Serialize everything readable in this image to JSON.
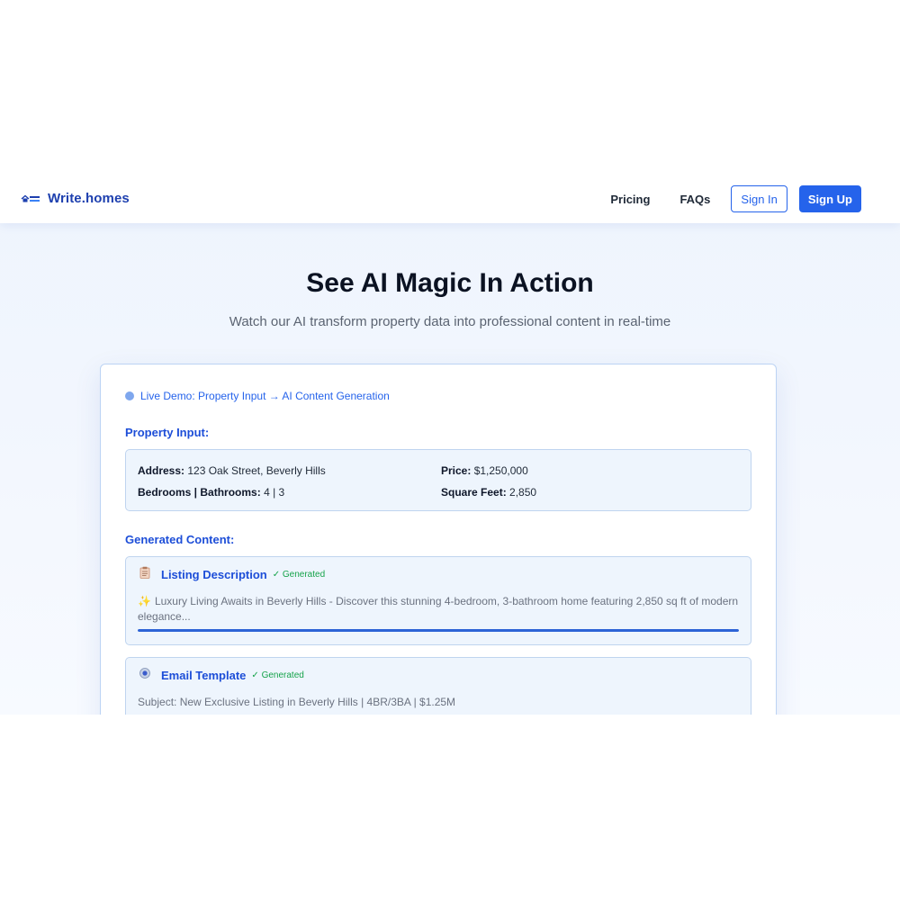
{
  "header": {
    "brand_name": "Write.homes",
    "nav": {
      "pricing": "Pricing",
      "faqs": "FAQs"
    },
    "sign_in": "Sign In",
    "sign_up": "Sign Up"
  },
  "hero": {
    "title": "See AI Magic In Action",
    "subtitle": "Watch our AI transform property data into professional content in real-time"
  },
  "demo": {
    "live_label": "Live Demo: Property Input → AI Content Generation",
    "property_input_label": "Property Input:",
    "property": {
      "address_label": "Address:",
      "address": "123 Oak Street, Beverly Hills",
      "bedbath_label": "Bedrooms | Bathrooms:",
      "bedbath": "4 | 3",
      "price_label": "Price:",
      "price": "$1,250,000",
      "sqft_label": "Square Feet:",
      "sqft": "2,850"
    },
    "generated_label": "Generated Content:",
    "items": [
      {
        "title": "Listing Description",
        "status": "✓ Generated",
        "icon": "clipboard-icon",
        "sparkle": "✨",
        "body": "Luxury Living Awaits in Beverly Hills - Discover this stunning 4-bedroom, 3-bathroom home featuring 2,850 sq ft of modern elegance...",
        "progress": 1.0
      },
      {
        "title": "Email Template",
        "status": "✓ Generated",
        "icon": "email-icon",
        "body": "Subject: New Exclusive Listing in Beverly Hills | 4BR/3BA | $1.25M"
      }
    ]
  },
  "colors": {
    "brand": "#1e40af",
    "primary": "#2563eb",
    "success": "#16a34a"
  }
}
